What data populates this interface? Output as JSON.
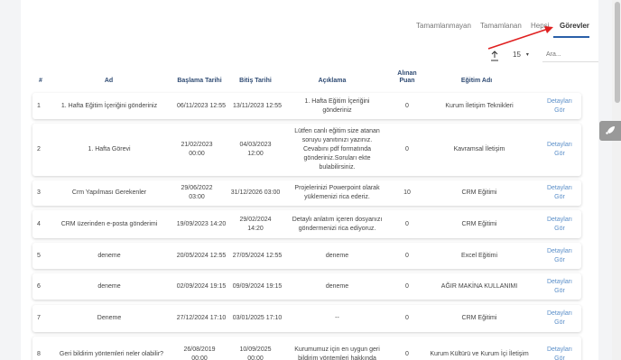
{
  "tabs": [
    {
      "label": "Tamamlanmayan"
    },
    {
      "label": "Tamamlanan"
    },
    {
      "label": "Hepsi"
    },
    {
      "label": "Görevler"
    }
  ],
  "toolbar": {
    "per_page": "15",
    "search_placeholder": "Ara..."
  },
  "table": {
    "headers": [
      "#",
      "Ad",
      "Başlama Tarihi",
      "Bitiş Tarihi",
      "Açıklama",
      "Alınan Puan",
      "Eğitim Adı",
      ""
    ],
    "rows": [
      {
        "no": "1",
        "name": "1. Hafta Eğitim İçeriğini gönderiniz",
        "start": "06/11/2023 12:55",
        "end": "13/11/2023 12:55",
        "desc": "1. Hafta Eğitim İçeriğini gönderiniz",
        "score": "0",
        "course": "Kurum İletişim Teknikleri",
        "detail": "Detayları Gör"
      },
      {
        "no": "2",
        "name": "1. Hafta Görevi",
        "start": "21/02/2023 00:00",
        "end": "04/03/2023 12:00",
        "desc": "Lütfen canlı eğitim size atanan soruyu yanıtınızı yazınız. Cevabını pdf formatında gönderiniz.Soruları ekte bulabilirsiniz.",
        "score": "0",
        "course": "Kavramsal İletişim",
        "detail": "Detayları Gör"
      },
      {
        "no": "3",
        "name": "Crm Yapılması Gerekenler",
        "start": "29/06/2022 03:00",
        "end": "31/12/2026 03:00",
        "desc": "Projelerinizi Powerpoint olarak yüklemenizi rica ederiz.",
        "score": "10",
        "course": "CRM Eğitimi",
        "detail": "Detayları Gör"
      },
      {
        "no": "4",
        "name": "CRM üzerinden e-posta gönderimi",
        "start": "19/09/2023 14:20",
        "end": "29/02/2024 14:20",
        "desc": "Detaylı anlatım içeren dosyanızı göndermenizi rica ediyoruz.",
        "score": "0",
        "course": "CRM Eğitimi",
        "detail": "Detayları Gör"
      },
      {
        "no": "5",
        "name": "deneme",
        "start": "20/05/2024 12:55",
        "end": "27/05/2024 12:55",
        "desc": "deneme",
        "score": "0",
        "course": "Excel Eğitimi",
        "detail": "Detayları Gör"
      },
      {
        "no": "6",
        "name": "deneme",
        "start": "02/09/2024 19:15",
        "end": "09/09/2024 19:15",
        "desc": "deneme",
        "score": "0",
        "course": "AĞIR MAKİNA KULLANIMI",
        "detail": "Detayları Gör"
      },
      {
        "no": "7",
        "name": "Deneme",
        "start": "27/12/2024 17:10",
        "end": "03/01/2025 17:10",
        "desc": "--",
        "score": "0",
        "course": "CRM Eğitimi",
        "detail": "Detayları Gör"
      },
      {
        "no": "8",
        "name": "Geri bildirim yöntemleri neler olabilir?",
        "start": "26/08/2019 00:00",
        "end": "10/09/2025 00:00",
        "desc": "Kurumumuz için en uygun geri bildirim yöntemleri hakkında",
        "score": "0",
        "course": "Kurum Kültürü ve Kurum İçi İletişim",
        "detail": "Detayları Gör"
      }
    ]
  },
  "colors": {
    "accent": "#2a5fa8",
    "link": "#5b8fc9",
    "header": "#2f4b73",
    "annotation_arrow": "#e02020"
  }
}
